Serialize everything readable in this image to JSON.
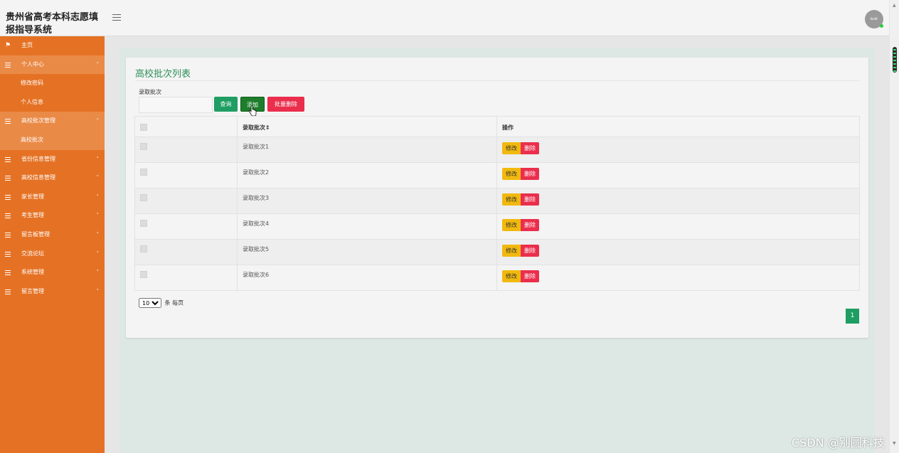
{
  "app": {
    "title": "贵州省高考本科志愿填报指导系统"
  },
  "header": {
    "avatar_text": "Kedlli"
  },
  "sidebar": {
    "items": [
      {
        "label": "主页",
        "type": "home"
      },
      {
        "label": "个人中心",
        "type": "group-open"
      },
      {
        "label": "修改密码",
        "type": "sub"
      },
      {
        "label": "个人信息",
        "type": "sub"
      },
      {
        "label": "高校批次管理",
        "type": "group-open"
      },
      {
        "label": "高校批次",
        "type": "sub-active"
      },
      {
        "label": "省份信息管理",
        "type": "group"
      },
      {
        "label": "高校信息管理",
        "type": "group"
      },
      {
        "label": "家长管理",
        "type": "group"
      },
      {
        "label": "考生管理",
        "type": "group"
      },
      {
        "label": "留言板管理",
        "type": "group"
      },
      {
        "label": "交流论坛",
        "type": "group"
      },
      {
        "label": "系统管理",
        "type": "group"
      },
      {
        "label": "留言管理",
        "type": "group"
      }
    ]
  },
  "main": {
    "title": "高校批次列表",
    "search": {
      "label": "录取批次",
      "value": "",
      "placeholder": ""
    },
    "buttons": {
      "query": "查询",
      "add": "添加",
      "batch_delete": "批量删除"
    },
    "table": {
      "headers": [
        "",
        "录取批次⇕",
        "操作"
      ],
      "rows": [
        {
          "batch": "录取批次1",
          "edit": "修改",
          "delete": "删除"
        },
        {
          "batch": "录取批次2",
          "edit": "修改",
          "delete": "删除"
        },
        {
          "batch": "录取批次3",
          "edit": "修改",
          "delete": "删除"
        },
        {
          "batch": "录取批次4",
          "edit": "修改",
          "delete": "删除"
        },
        {
          "batch": "录取批次5",
          "edit": "修改",
          "delete": "删除"
        },
        {
          "batch": "录取批次6",
          "edit": "修改",
          "delete": "删除"
        }
      ]
    },
    "pagination": {
      "page_size": "10",
      "page_size_suffix": "条 每页",
      "current_page": "1"
    }
  },
  "watermark": "CSDN @别圆科技",
  "colors": {
    "sidebar": "#e57224",
    "sidebar_active": "#ea8a47",
    "primary": "#1e9e62",
    "danger": "#ea2e4c",
    "warning": "#f1b90f",
    "title": "#2f8f5a"
  }
}
